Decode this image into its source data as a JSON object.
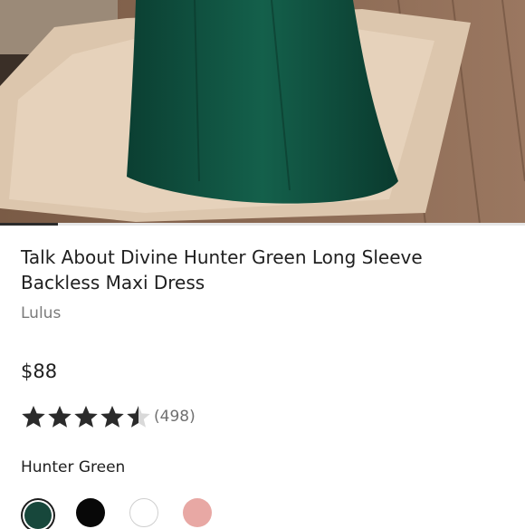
{
  "product": {
    "title": "Talk About Divine Hunter Green Long Sleeve Backless Maxi Dress",
    "brand": "Lulus",
    "price": "$88",
    "rating": 4.5,
    "review_count": "(498)",
    "color_name": "Hunter Green"
  },
  "image_carousel": {
    "progress_fraction": 0.11
  },
  "colors": {
    "star": "#2b2b2b",
    "star_empty": "#d9d9d9",
    "dress": "#0f4a3b"
  },
  "swatches": [
    {
      "name": "hunter green",
      "color": "#17473b",
      "selected": true
    },
    {
      "name": "black",
      "color": "#080808",
      "selected": false
    },
    {
      "name": "white",
      "color": "#ffffff",
      "selected": false
    },
    {
      "name": "blush",
      "color": "#e8a8a4",
      "selected": false
    }
  ]
}
